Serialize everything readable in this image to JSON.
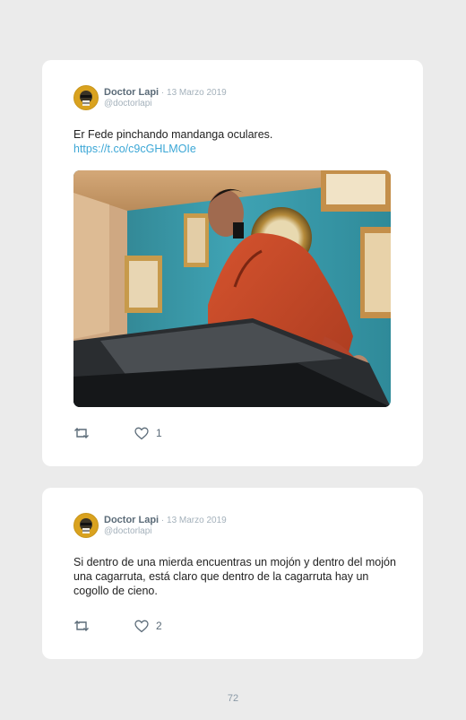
{
  "tweets": [
    {
      "author_name": "Doctor Lapi",
      "date": " · 13 Marzo 2019",
      "handle": "@doctorlapi",
      "text": "Er Fede pinchando mandanga oculares.",
      "link": "https://t.co/c9cGHLMOIe",
      "has_photo": true,
      "like_count": "1",
      "icons": [
        "retweet-icon",
        "heart-icon"
      ]
    },
    {
      "author_name": "Doctor Lapi",
      "date": " · 13 Marzo 2019",
      "handle": "@doctorlapi",
      "text": "Si dentro de una mierda encuentras un mojón y dentro del mojón una cagarruta, está claro que dentro de la cagarruta hay un cogollo de cieno.",
      "has_photo": false,
      "like_count": "2",
      "icons": [
        "retweet-icon",
        "heart-icon"
      ]
    }
  ],
  "page_number": "72",
  "colors": {
    "background": "#ebebeb",
    "card": "#ffffff",
    "link": "#3ca7d6",
    "name": "#5b6b78",
    "muted": "#a4b1bb"
  }
}
